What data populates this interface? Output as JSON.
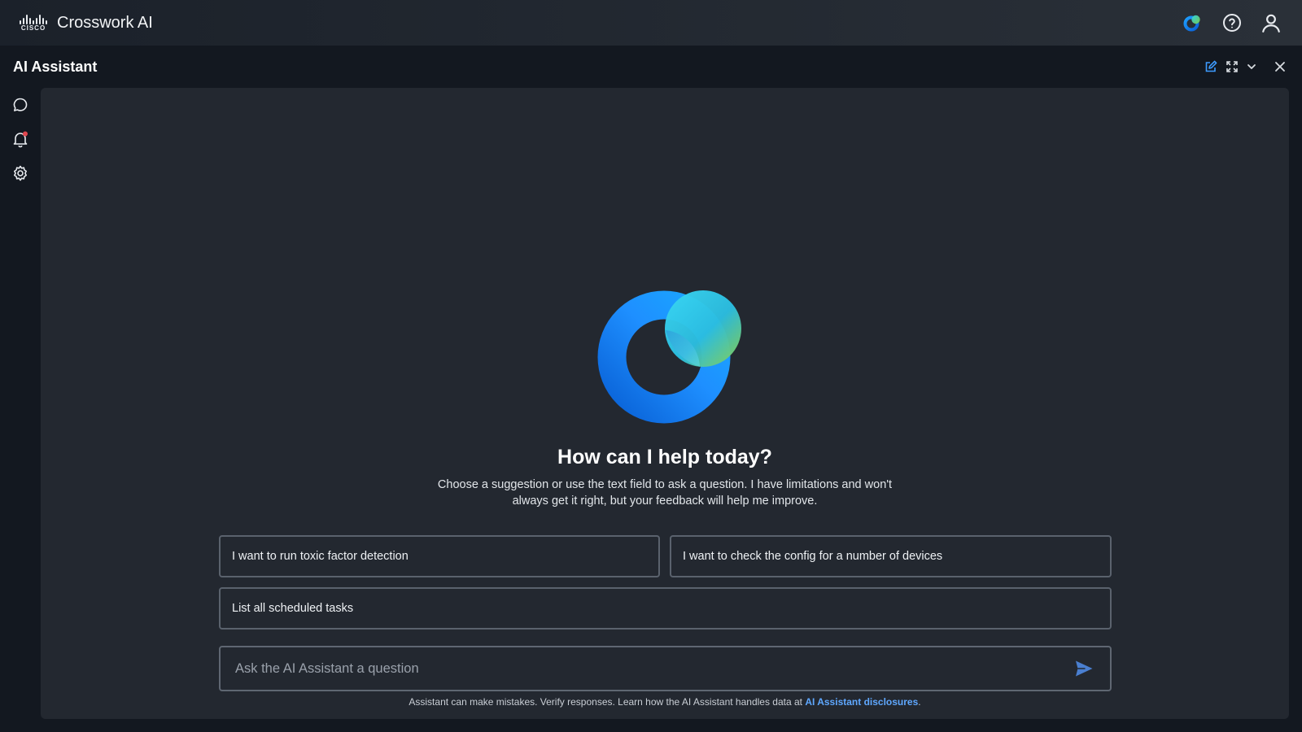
{
  "topbar": {
    "brand_word": "CISCO",
    "app_title": "Crosswork AI",
    "icons": [
      "ai-assistant-icon",
      "help-icon",
      "user-icon"
    ]
  },
  "assistant": {
    "title": "AI Assistant",
    "header_actions": [
      "edit-icon",
      "expand-icon",
      "chevron-down-icon",
      "close-icon"
    ]
  },
  "rail": {
    "items": [
      "chat-icon",
      "bell-icon",
      "gear-icon"
    ],
    "notification_dot_color": "#e0464e"
  },
  "main": {
    "welcome_title": "How can I help today?",
    "welcome_text": "Choose a suggestion or use the text field to ask a question. I have limitations and won't always get it right, but your feedback will help me improve.",
    "suggestions": [
      "I want to run toxic factor detection",
      "I want to check the config for a number of devices",
      "List all scheduled tasks"
    ],
    "input_placeholder": "Ask the AI Assistant a question",
    "disclaimer_prefix": "Assistant can make mistakes. Verify responses. Learn how the AI Assistant handles data at ",
    "disclaimer_link": "AI Assistant disclosures",
    "disclaimer_suffix": "."
  },
  "colors": {
    "accent": "#1e8fff",
    "link": "#5fa8ff",
    "panel": "#232830",
    "background": "#131820"
  }
}
